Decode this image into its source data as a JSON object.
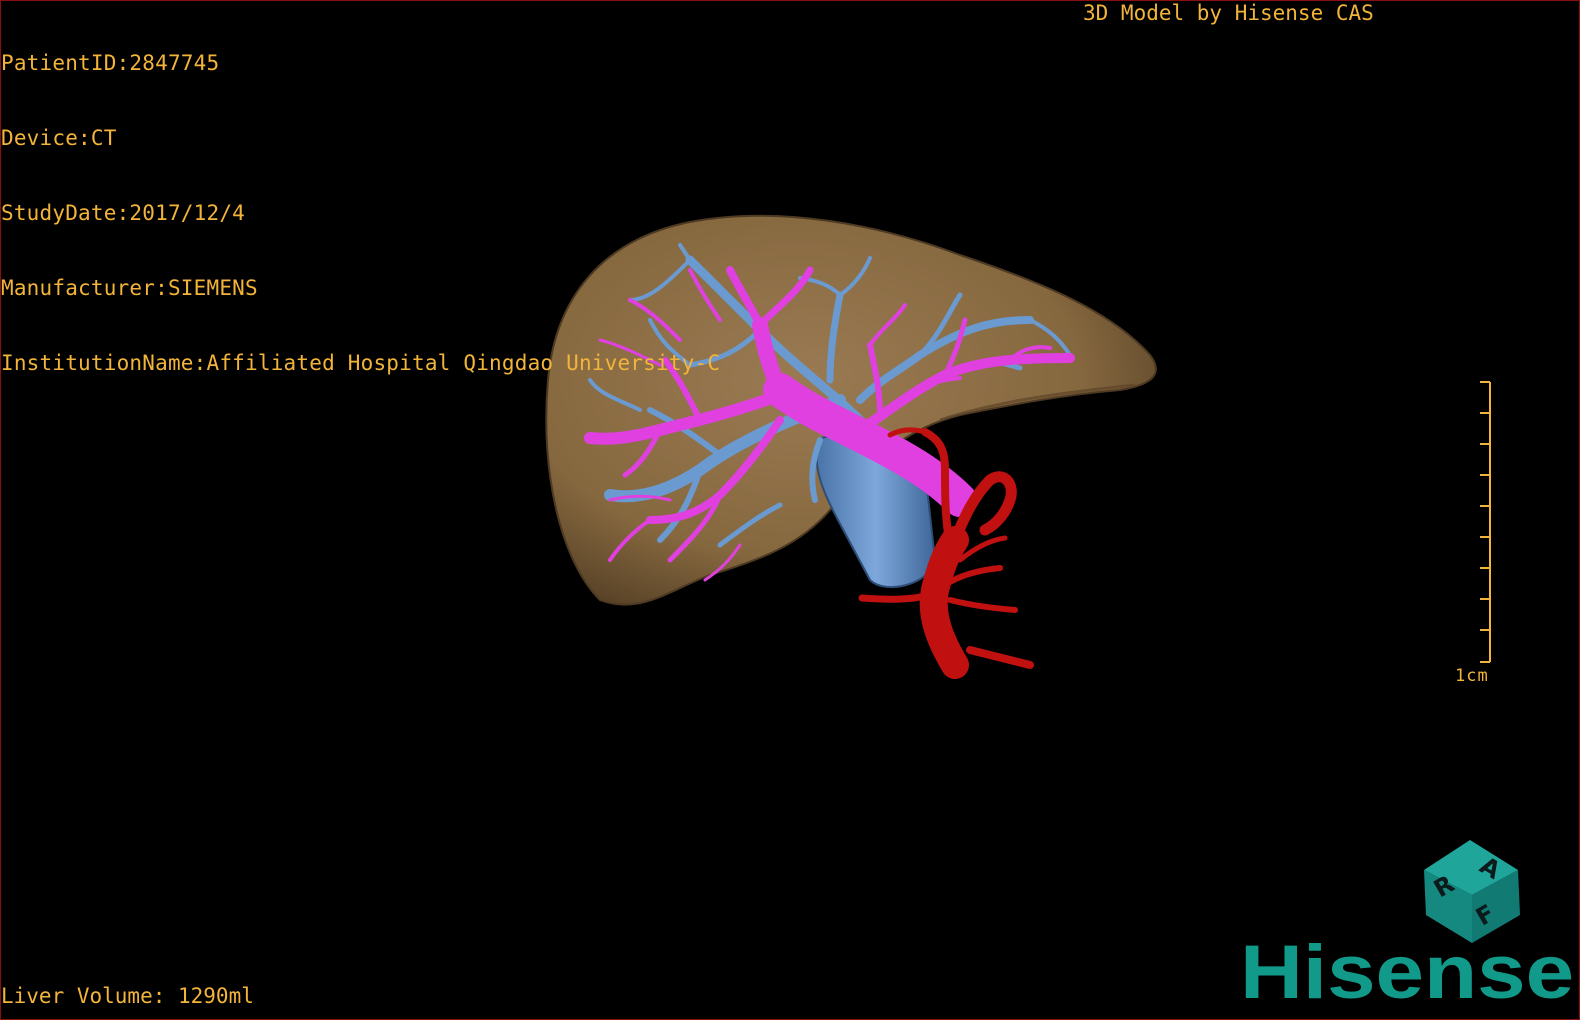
{
  "header": {
    "patient_id": "PatientID:2847745",
    "device": "Device:CT",
    "study_date": "StudyDate:2017/12/4",
    "manufacturer": "Manufacturer:SIEMENS",
    "institution": "InstitutionName:Affiliated Hospital Qingdao University-C",
    "credit": "3D Model by Hisense CAS"
  },
  "footer": {
    "liver_volume": "Liver Volume: 1290ml"
  },
  "scale": {
    "label": "1cm"
  },
  "orientation_cube": {
    "letters": [
      "R",
      "A",
      "F"
    ]
  },
  "brand": {
    "name": "Hisense"
  },
  "colors": {
    "overlay_text": "#f3b43a",
    "liver": "#8a6b45",
    "portal_vein": "#e040e0",
    "hepatic_vein": "#6a9ad0",
    "artery": "#c01010",
    "brand": "#119a8a",
    "frame": "#8a1010"
  }
}
